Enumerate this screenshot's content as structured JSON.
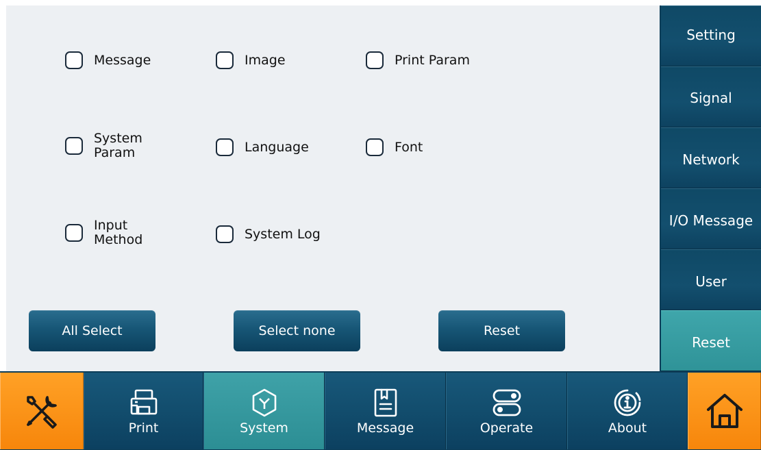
{
  "checkboxes": [
    {
      "label": "Message",
      "checked": false
    },
    {
      "label": "Image",
      "checked": false
    },
    {
      "label": "Print Param",
      "checked": false
    },
    {
      "label": "System\nParam",
      "checked": false
    },
    {
      "label": "Language",
      "checked": false
    },
    {
      "label": "Font",
      "checked": false
    },
    {
      "label": "Input\nMethod",
      "checked": false
    },
    {
      "label": "System Log",
      "checked": false
    }
  ],
  "actions": {
    "all_select": "All Select",
    "select_none": "Select none",
    "reset": "Reset"
  },
  "sidebar": {
    "items": [
      {
        "label": "Setting"
      },
      {
        "label": "Signal"
      },
      {
        "label": "Network"
      },
      {
        "label": "I/O Message"
      },
      {
        "label": "User"
      },
      {
        "label": "Reset",
        "active": true
      }
    ]
  },
  "bottom_nav": {
    "tools_icon": "tools-icon",
    "items": [
      {
        "label": "Print",
        "icon": "printer-icon"
      },
      {
        "label": "System",
        "icon": "system-icon",
        "active": true
      },
      {
        "label": "Message",
        "icon": "message-icon"
      },
      {
        "label": "Operate",
        "icon": "operate-icon"
      },
      {
        "label": "About",
        "icon": "info-icon"
      }
    ],
    "home_icon": "home-icon"
  },
  "colors": {
    "accent_orange": "#f7860b",
    "nav_blue": "#124d6d",
    "active_teal": "#2f9398",
    "panel_bg": "#edf0f3"
  }
}
